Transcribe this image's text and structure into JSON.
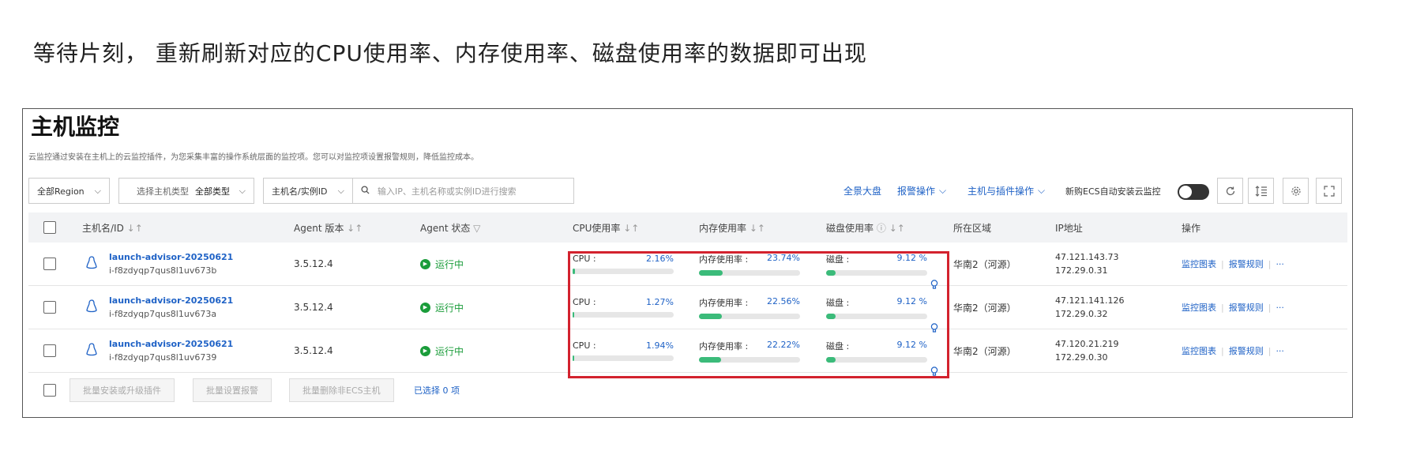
{
  "caption": "等待片刻， 重新刷新对应的CPU使用率、内存使用率、磁盘使用率的数据即可出现",
  "page": {
    "title": "主机监控",
    "description": "云监控通过安装在主机上的云监控插件，为您采集丰富的操作系统层面的监控项。您可以对监控项设置报警规则，降低监控成本。"
  },
  "toolbar": {
    "region": "全部Region",
    "host_type_label": "选择主机类型",
    "host_type_value": "全部类型",
    "search_field": "主机名/实例ID",
    "search_placeholder": "输入IP、主机名称或实例ID进行搜索",
    "link_dashboard": "全景大盘",
    "link_alarm_ops": "报警操作",
    "link_host_plugin_ops": "主机与插件操作",
    "auto_install_label": "新购ECS自动安装云监控",
    "chevron": "⌵"
  },
  "table": {
    "headers": {
      "host": "主机名/ID",
      "agent_version": "Agent 版本",
      "agent_status": "Agent 状态",
      "cpu": "CPU使用率",
      "memory": "内存使用率",
      "disk": "磁盘使用率",
      "region": "所在区域",
      "ip": "IP地址",
      "actions": "操作"
    },
    "sort_icon": "↓↑",
    "filter_icon": "▽",
    "info_icon": "ⓘ",
    "rows": [
      {
        "host_name": "launch-advisor-20250621",
        "instance_id": "i-f8zdyqp7qus8l1uv673b",
        "agent_version": "3.5.12.4",
        "status": "运行中",
        "cpu_label": "CPU :",
        "cpu_value": "2.16%",
        "cpu_pct": 2.16,
        "mem_label": "内存使用率 :",
        "mem_value": "23.74%",
        "mem_pct": 23.74,
        "disk_label": "磁盘 :",
        "disk_value": "9.12 %",
        "disk_pct": 9.12,
        "region": "华南2（河源）",
        "ip_public": "47.121.143.73",
        "ip_private": "172.29.0.31"
      },
      {
        "host_name": "launch-advisor-20250621",
        "instance_id": "i-f8zdyqp7qus8l1uv673a",
        "agent_version": "3.5.12.4",
        "status": "运行中",
        "cpu_label": "CPU :",
        "cpu_value": "1.27%",
        "cpu_pct": 1.27,
        "mem_label": "内存使用率 :",
        "mem_value": "22.56%",
        "mem_pct": 22.56,
        "disk_label": "磁盘 :",
        "disk_value": "9.12 %",
        "disk_pct": 9.12,
        "region": "华南2（河源）",
        "ip_public": "47.121.141.126",
        "ip_private": "172.29.0.32"
      },
      {
        "host_name": "launch-advisor-20250621",
        "instance_id": "i-f8zdyqp7qus8l1uv6739",
        "agent_version": "3.5.12.4",
        "status": "运行中",
        "cpu_label": "CPU :",
        "cpu_value": "1.94%",
        "cpu_pct": 1.94,
        "mem_label": "内存使用率 :",
        "mem_value": "22.22%",
        "mem_pct": 22.22,
        "disk_label": "磁盘 :",
        "disk_value": "9.12 %",
        "disk_pct": 9.12,
        "region": "华南2（河源）",
        "ip_public": "47.120.21.219",
        "ip_private": "172.29.0.30"
      }
    ],
    "action_chart": "监控图表",
    "action_rules": "报警规则",
    "action_more": "···"
  },
  "footer": {
    "batch_install": "批量安装或升级插件",
    "batch_alarm": "批量设置报警",
    "batch_delete": "批量删除非ECS主机",
    "selected": "已选择 0 项"
  },
  "colors": {
    "link": "#1f62c6",
    "running": "#1a9c3a",
    "bar_fill": "#3bbb7a",
    "highlight": "#d3222e"
  }
}
